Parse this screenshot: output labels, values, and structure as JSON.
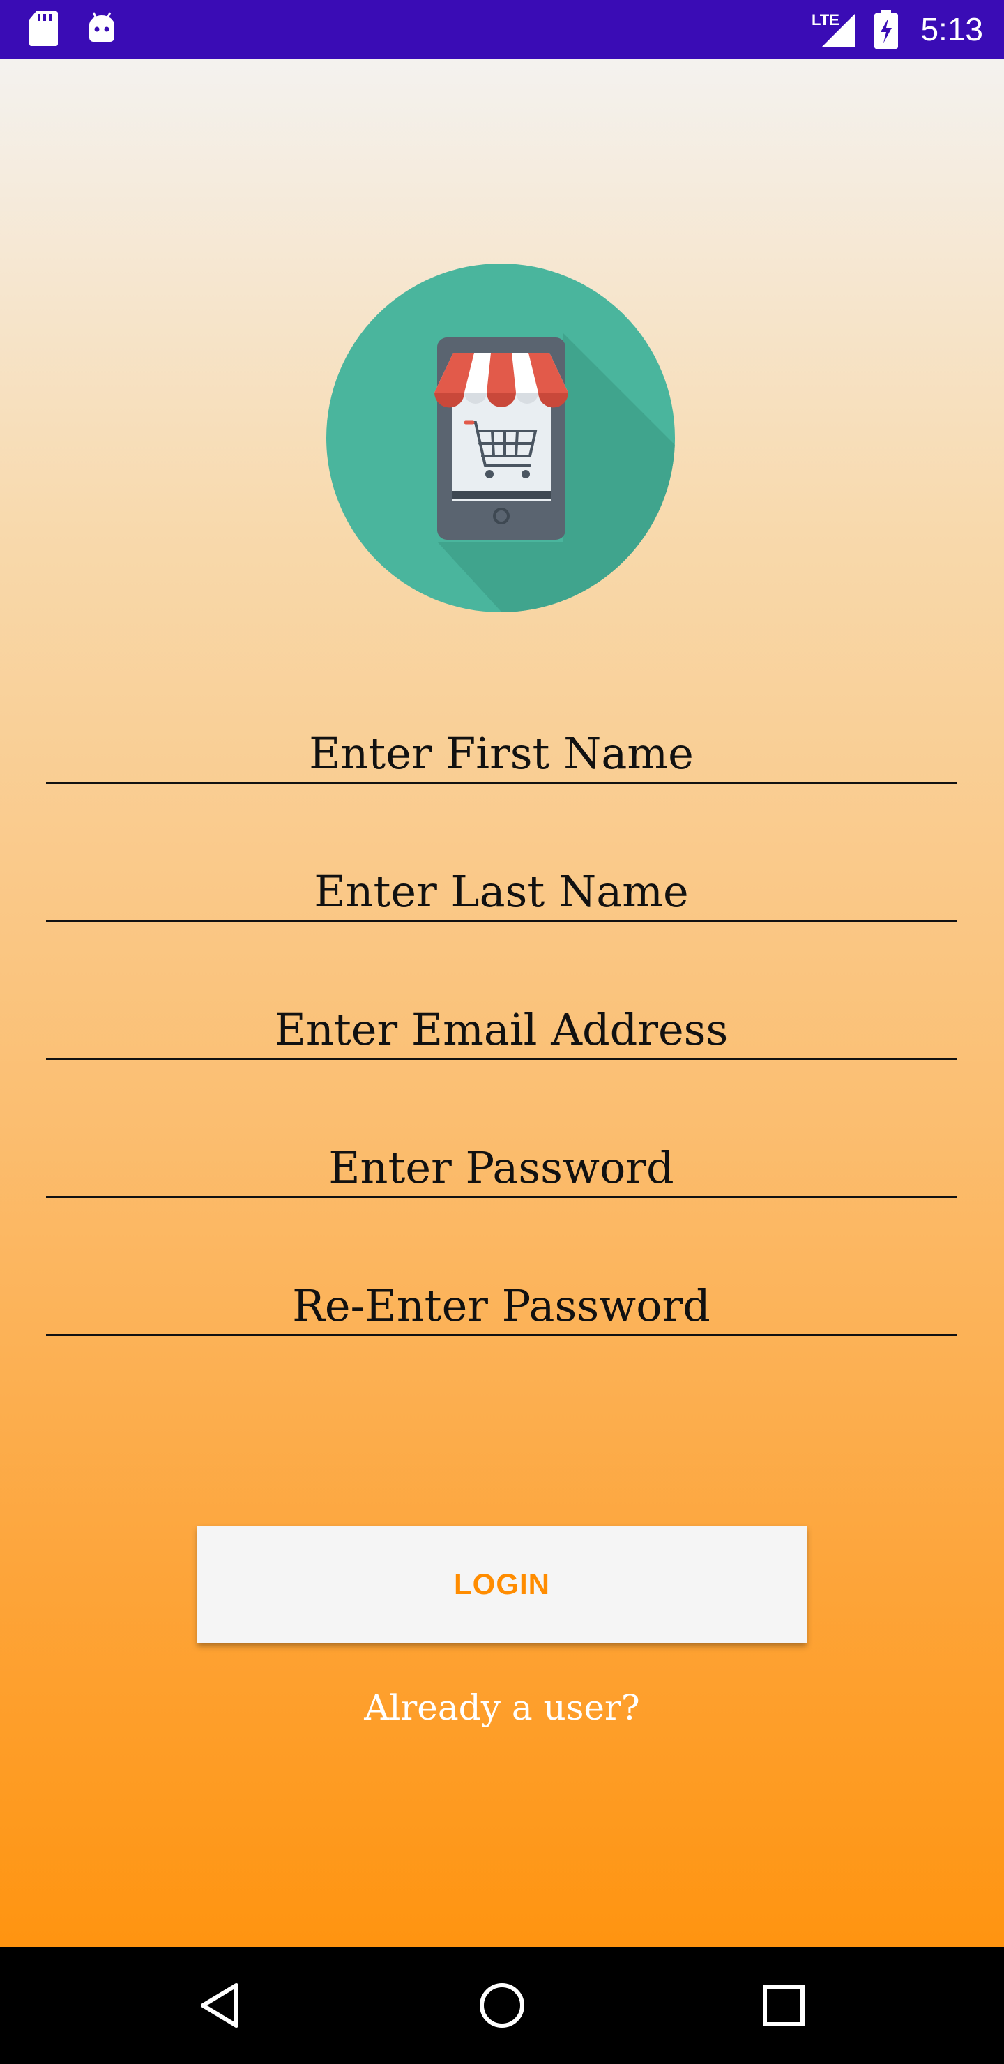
{
  "status_bar": {
    "time": "5:13",
    "network": "LTE",
    "icons": [
      "sd-card-icon",
      "android-icon",
      "signal-icon",
      "battery-charging-icon"
    ],
    "color": "#3a0cb5"
  },
  "logo": {
    "icon": "shop-cart-phone-icon",
    "colors": {
      "circle": "#4ab59d",
      "phone": "#5a6470",
      "awning_red": "#e25a4a"
    }
  },
  "form": {
    "first_name": {
      "placeholder": "Enter First Name",
      "value": ""
    },
    "last_name": {
      "placeholder": "Enter Last Name",
      "value": ""
    },
    "email": {
      "placeholder": "Enter Email Address",
      "value": ""
    },
    "password": {
      "placeholder": "Enter Password",
      "value": ""
    },
    "confirm_password": {
      "placeholder": "Re-Enter Password",
      "value": ""
    }
  },
  "login_button": {
    "label": "LOGIN",
    "color": "#ff8c00"
  },
  "already_user_link": {
    "label": "Already a user?"
  },
  "navigation": {
    "icons": [
      "back-icon",
      "home-icon",
      "recents-icon"
    ]
  }
}
